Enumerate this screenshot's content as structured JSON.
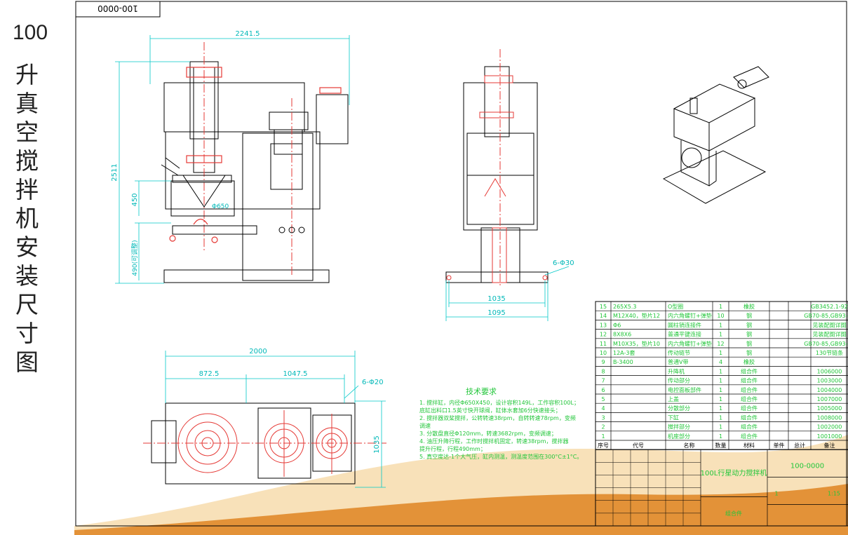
{
  "title_number": "100",
  "title_text": "升真空搅拌机安装尺寸图",
  "drawing_number_box": "100-0000",
  "dims": {
    "front_width": "2241.5",
    "front_height": "2511",
    "front_450": "450",
    "front_650": "Φ650",
    "front_490": "490(可调整)",
    "side_1035": "1035",
    "side_1095": "1095",
    "side_holes": "6-Φ30",
    "top_2000": "2000",
    "top_872": "872.5",
    "top_1047": "1047.5",
    "top_1035": "1035",
    "top_holes": "6-Φ20"
  },
  "tech": {
    "heading": "技术要求",
    "lines": [
      "1. 搅拌缸，内径Φ650X450，设计容积149L，工作容积100L；",
      "   底缸出料口1.5英寸快开球阀，缸体水套加6分快速接头；",
      "2. 搅拌器双桨搅拌，公转转速38rpm，自转转速78rpm，变频",
      "   调速",
      "3. 分散盘直径Φ120mm，转速3682rpm，变频调速；",
      "4. 油压升降行程，工作时搅拌机固定，转速38rpm，搅拌器",
      "   提升行程，行程490mm；",
      "5. 真空度达-1个大气压，缸内测温，测温度范围在300°C±1°C。"
    ]
  },
  "bom": {
    "rows": [
      [
        "15",
        "265X5.3",
        "O型圈",
        "1",
        "橡胶",
        "",
        "",
        "GB3452.1-92"
      ],
      [
        "14",
        "M12X40，垫片12",
        "内六角螺钉+弹垫",
        "10",
        "钢",
        "",
        "",
        "GB70-85,GB93-87"
      ],
      [
        "13",
        "Φ6",
        "圆柱销连接件",
        "1",
        "钢",
        "",
        "",
        "见装配图详图"
      ],
      [
        "12",
        "8X8X6",
        "普通平键连接",
        "1",
        "钢",
        "",
        "",
        "见装配图详图"
      ],
      [
        "11",
        "M10X35，垫片10",
        "内六角螺钉+弹垫",
        "12",
        "钢",
        "",
        "",
        "GB70-85,GB93-87"
      ],
      [
        "10",
        "12A-3套",
        "传动链节",
        "1",
        "钢",
        "",
        "",
        "130节链条"
      ],
      [
        "9",
        "B-3400",
        "普通V带",
        "4",
        "橡胶",
        "",
        "",
        ""
      ],
      [
        "8",
        "",
        "升降机",
        "1",
        "组合件",
        "",
        "",
        "1006000"
      ],
      [
        "7",
        "",
        "传动部分",
        "1",
        "组合件",
        "",
        "",
        "1003000"
      ],
      [
        "6",
        "",
        "电控面板部件",
        "1",
        "组合件",
        "",
        "",
        "1004000"
      ],
      [
        "5",
        "",
        "上盖",
        "1",
        "组合件",
        "",
        "",
        "1007000"
      ],
      [
        "4",
        "",
        "分散部分",
        "1",
        "组合件",
        "",
        "",
        "1005000"
      ],
      [
        "3",
        "",
        "下缸",
        "1",
        "组合件",
        "",
        "",
        "1008000"
      ],
      [
        "2",
        "",
        "搅拌部分",
        "1",
        "组合件",
        "",
        "",
        "1002000"
      ],
      [
        "1",
        "",
        "机座部分",
        "1",
        "组合件",
        "",
        "",
        "1001000"
      ]
    ],
    "header": [
      "序号",
      "代号",
      "名称",
      "数量",
      "材料",
      "单件",
      "总计",
      "备注"
    ],
    "product": "100L行星动力搅拌机",
    "assembly": "组合件",
    "drawing_no": "100-0000",
    "scale": "1:15",
    "qty": "1"
  },
  "colors": {
    "line": "#000000",
    "dim": "#00d8d8",
    "note": "#22c63a",
    "red": "#e53935",
    "wave1": "#f1c27d",
    "wave2": "#e08a2a"
  }
}
